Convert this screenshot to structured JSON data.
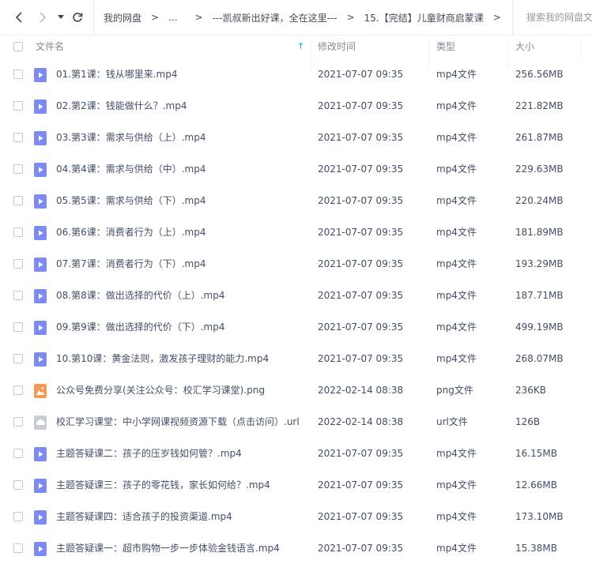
{
  "nav": {
    "back_icon": "chevron-left-icon",
    "forward_icon": "chevron-right-icon",
    "dropdown_icon": "caret-down-icon",
    "refresh_icon": "refresh-icon"
  },
  "breadcrumb": [
    {
      "label": "我的网盘"
    },
    {
      "label": "..."
    },
    {
      "label": "---凯叔新出好课，全在这里---"
    },
    {
      "label": "15.【完结】儿童财商启蒙课"
    }
  ],
  "breadcrumb_sep": ">",
  "search": {
    "placeholder": "搜索我的网盘文件"
  },
  "columns": {
    "name": "文件名",
    "modified": "修改时间",
    "type": "类型",
    "size": "大小",
    "sort_indicator": "↑"
  },
  "colors": {
    "video_icon": "#7d8af3",
    "image_icon": "#f59a52",
    "link_icon": "#c8ccd3",
    "sort_arrow": "#06a7ff"
  },
  "files": [
    {
      "name": "01.第1课：钱从哪里来.mp4",
      "modified": "2021-07-07 09:35",
      "type": "mp4文件",
      "size": "256.56MB",
      "icon": "video-file-icon"
    },
    {
      "name": "02.第2课：钱能做什么？.mp4",
      "modified": "2021-07-07 09:35",
      "type": "mp4文件",
      "size": "221.82MB",
      "icon": "video-file-icon"
    },
    {
      "name": "03.第3课：需求与供给（上）.mp4",
      "modified": "2021-07-07 09:35",
      "type": "mp4文件",
      "size": "261.87MB",
      "icon": "video-file-icon"
    },
    {
      "name": "04.第4课：需求与供给（中）.mp4",
      "modified": "2021-07-07 09:35",
      "type": "mp4文件",
      "size": "229.63MB",
      "icon": "video-file-icon"
    },
    {
      "name": "05.第5课：需求与供给（下）.mp4",
      "modified": "2021-07-07 09:35",
      "type": "mp4文件",
      "size": "220.24MB",
      "icon": "video-file-icon"
    },
    {
      "name": "06.第6课：消费者行为（上）.mp4",
      "modified": "2021-07-07 09:35",
      "type": "mp4文件",
      "size": "181.89MB",
      "icon": "video-file-icon"
    },
    {
      "name": "07.第7课：消费者行为（下）.mp4",
      "modified": "2021-07-07 09:35",
      "type": "mp4文件",
      "size": "193.29MB",
      "icon": "video-file-icon"
    },
    {
      "name": "08.第8课：做出选择的代价（上）.mp4",
      "modified": "2021-07-07 09:35",
      "type": "mp4文件",
      "size": "187.71MB",
      "icon": "video-file-icon"
    },
    {
      "name": "09.第9课：做出选择的代价（下）.mp4",
      "modified": "2021-07-07 09:35",
      "type": "mp4文件",
      "size": "499.19MB",
      "icon": "video-file-icon"
    },
    {
      "name": "10.第10课：黄金法则，激发孩子理财的能力.mp4",
      "modified": "2021-07-07 09:35",
      "type": "mp4文件",
      "size": "268.07MB",
      "icon": "video-file-icon"
    },
    {
      "name": "公众号免费分享(关注公众号：校汇学习课堂).png",
      "modified": "2022-02-14 08:38",
      "type": "png文件",
      "size": "236KB",
      "icon": "image-file-icon"
    },
    {
      "name": "校汇学习课堂：中小学网课视频资源下载（点击访问）.url",
      "modified": "2022-02-14 08:38",
      "type": "url文件",
      "size": "126B",
      "icon": "link-file-icon"
    },
    {
      "name": "主题答疑课二：孩子的压岁钱如何管？.mp4",
      "modified": "2021-07-07 09:35",
      "type": "mp4文件",
      "size": "16.15MB",
      "icon": "video-file-icon"
    },
    {
      "name": "主题答疑课三：孩子的零花钱，家长如何给？.mp4",
      "modified": "2021-07-07 09:35",
      "type": "mp4文件",
      "size": "12.66MB",
      "icon": "video-file-icon"
    },
    {
      "name": "主题答疑课四：适合孩子的投资渠道.mp4",
      "modified": "2021-07-07 09:35",
      "type": "mp4文件",
      "size": "173.10MB",
      "icon": "video-file-icon"
    },
    {
      "name": "主题答疑课一：超市购物一步一步体验金钱语言.mp4",
      "modified": "2021-07-07 09:35",
      "type": "mp4文件",
      "size": "15.38MB",
      "icon": "video-file-icon"
    }
  ]
}
